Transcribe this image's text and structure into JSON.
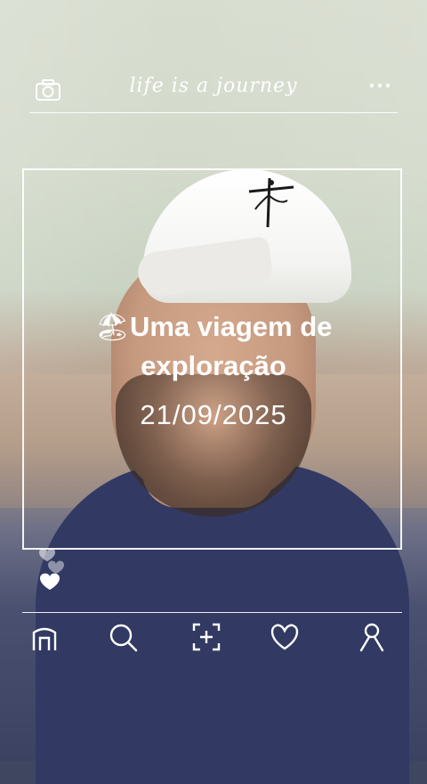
{
  "top_bar": {
    "tagline": "life is a journey",
    "left_icon": "camera-icon",
    "right_icon": "more-icon"
  },
  "post": {
    "caption_emoji": "🏖",
    "caption_line1": "Uma viagem de",
    "caption_line2": "exploração",
    "date": "21/09/2025"
  },
  "bottom_nav": {
    "items": [
      "home-icon",
      "search-icon",
      "add-icon",
      "heart-icon",
      "profile-icon"
    ]
  },
  "colors": {
    "frame": "#ffffff",
    "shirt": "#323a63",
    "cap": "#ffffff"
  }
}
